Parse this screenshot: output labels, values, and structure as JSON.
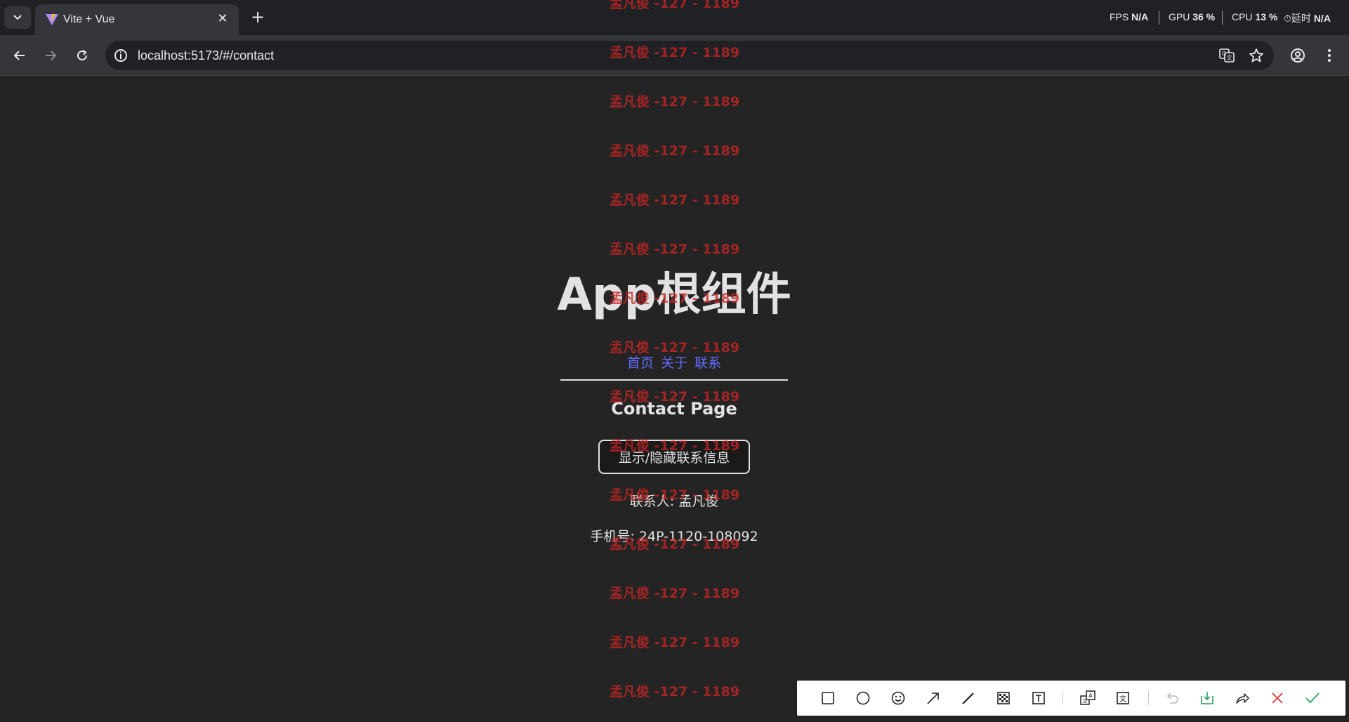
{
  "browser": {
    "tab": {
      "title": "Vite + Vue"
    },
    "address": {
      "url": "localhost:5173/#/contact"
    },
    "perf": {
      "fps_label": "FPS",
      "fps_value": "N/A",
      "gpu_label": "GPU",
      "gpu_value": "36 %",
      "cpu_label": "CPU",
      "cpu_value": "13 %",
      "latency_label": "延时",
      "latency_value": "N/A"
    }
  },
  "watermark": {
    "text": "孟凡俊 -127 - 1189",
    "color": "#c82424"
  },
  "app": {
    "title": "App根组件",
    "nav": [
      {
        "label": "首页"
      },
      {
        "label": "关于"
      },
      {
        "label": "联系"
      }
    ],
    "page_heading": "Contact Page",
    "toggle_button": "显示/隐藏联系信息",
    "contact_person": "联系人: 孟凡俊",
    "phone": "手机号: 24P-1120-108092",
    "link_color": "#646cff"
  },
  "annotation_toolbar": {
    "tools": [
      {
        "icon": "rectangle-icon"
      },
      {
        "icon": "ellipse-icon"
      },
      {
        "icon": "emoji-icon"
      },
      {
        "icon": "arrow-icon"
      },
      {
        "icon": "pen-icon"
      },
      {
        "icon": "mosaic-icon"
      },
      {
        "icon": "text-icon"
      },
      {
        "icon": "translate-icon"
      },
      {
        "icon": "ocr-icon"
      },
      {
        "icon": "undo-icon"
      },
      {
        "icon": "save-icon"
      },
      {
        "icon": "share-icon"
      },
      {
        "icon": "cancel-icon"
      },
      {
        "icon": "confirm-icon"
      }
    ]
  }
}
